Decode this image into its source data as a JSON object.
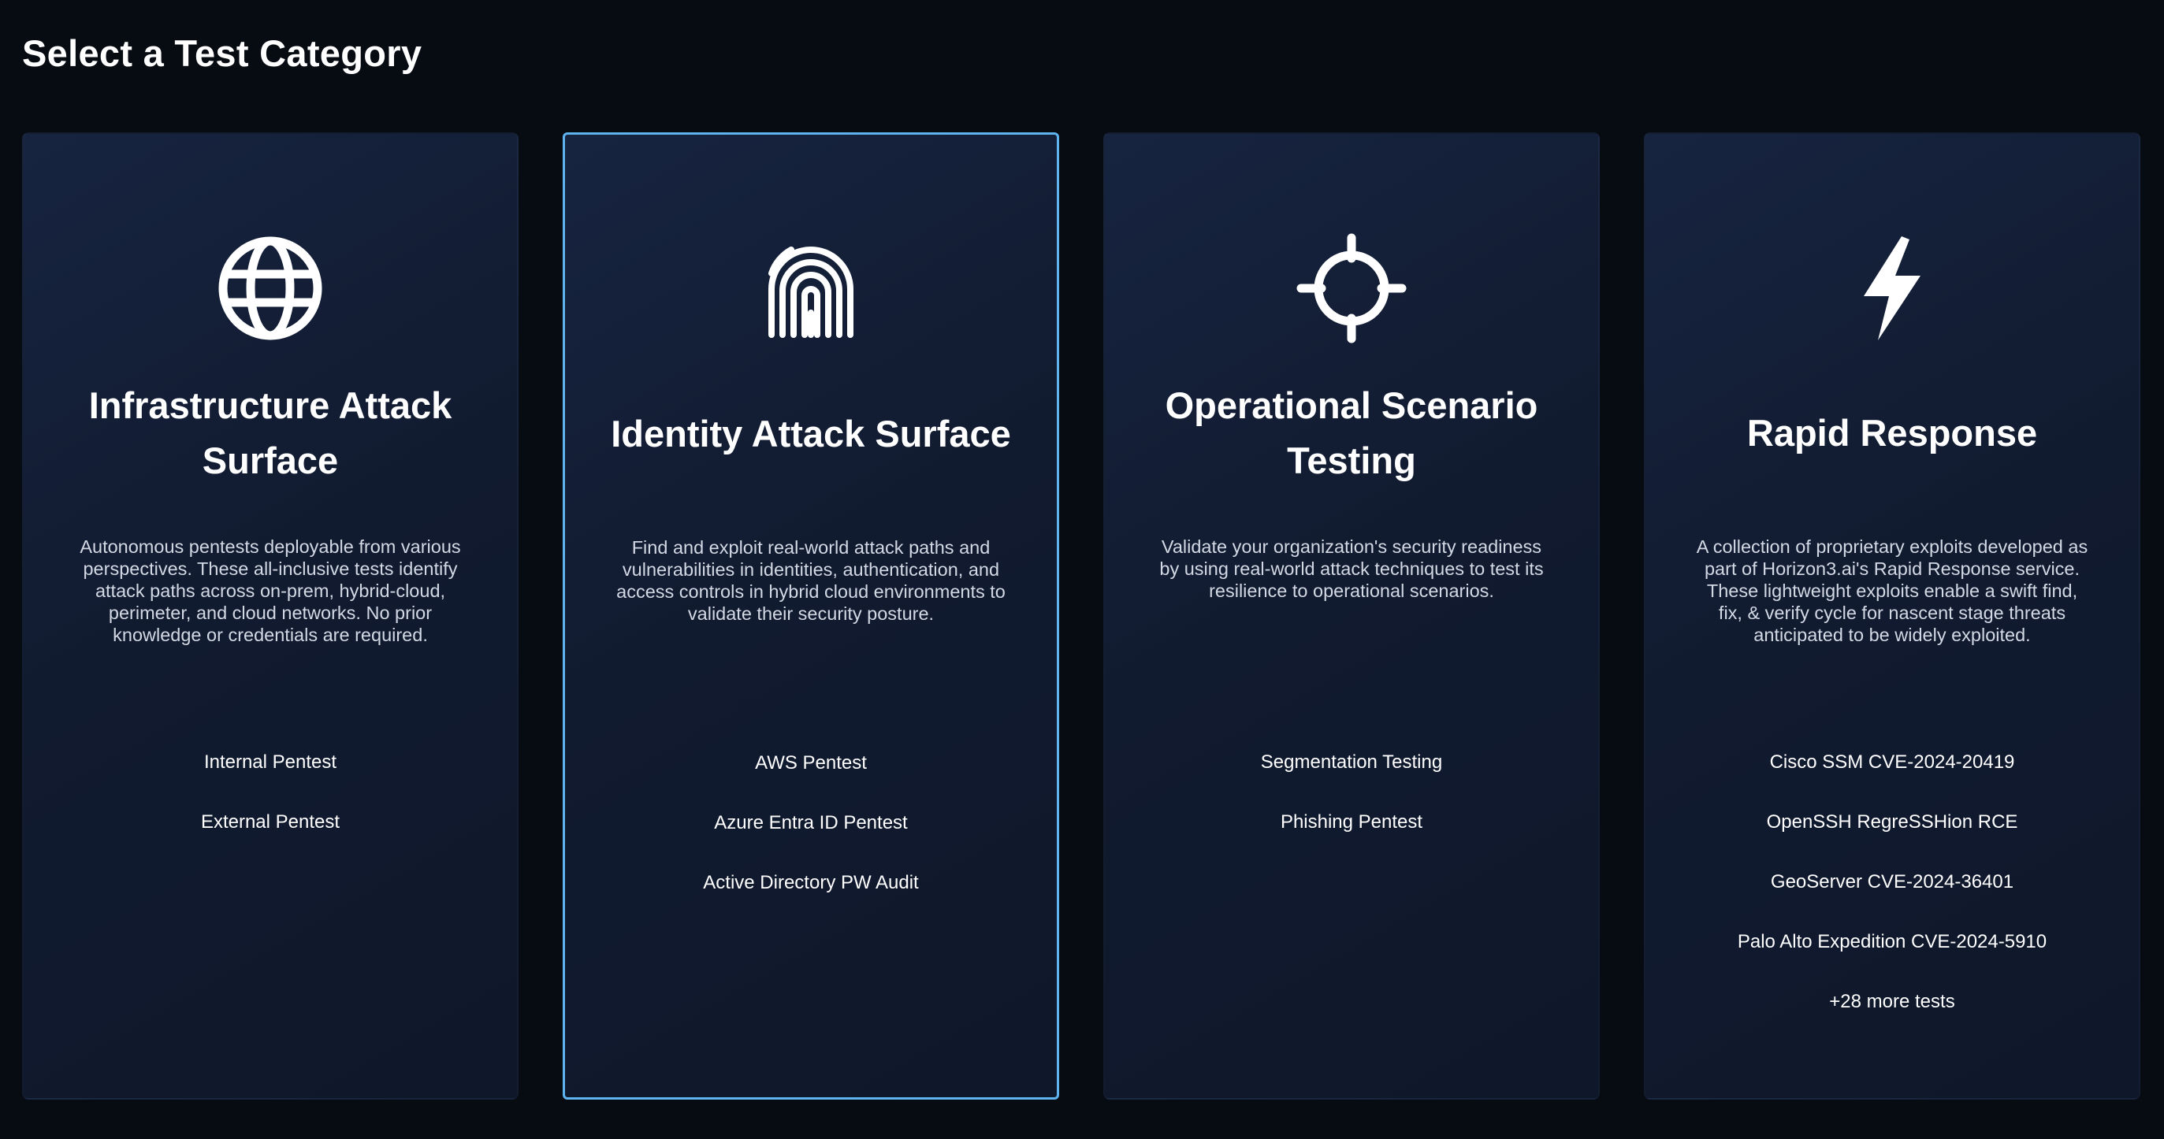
{
  "page": {
    "title": "Select a Test Category"
  },
  "colors": {
    "background": "#070b12",
    "card": "#131e36",
    "selected_border": "#5fb4f0",
    "text": "#ffffff",
    "muted_text": "#d3d9e4"
  },
  "cards": [
    {
      "icon": "globe-icon",
      "title": "Infrastructure Attack Surface",
      "description": "Autonomous pentests deployable from various perspectives. These all-inclusive tests identify attack paths across on-prem, hybrid-cloud, perimeter, and cloud networks. No prior knowledge or credentials are required.",
      "tests": [
        "Internal Pentest",
        "External Pentest"
      ]
    },
    {
      "icon": "fingerprint-icon",
      "title": "Identity Attack Surface",
      "description": "Find and exploit real-world attack paths and vulnerabilities in identities, authentication, and access controls in hybrid cloud environments to validate their security posture.",
      "tests": [
        "AWS Pentest",
        "Azure Entra ID Pentest",
        "Active Directory PW Audit"
      ],
      "selected": true
    },
    {
      "icon": "crosshair-icon",
      "title": "Operational Scenario Testing",
      "description": "Validate your organization's security readiness by using real-world attack techniques to test its resilience to operational scenarios.",
      "tests": [
        "Segmentation Testing",
        "Phishing Pentest"
      ]
    },
    {
      "icon": "lightning-icon",
      "title": "Rapid Response",
      "description": "A collection of proprietary exploits developed as part of Horizon3.ai's Rapid Response service. These lightweight exploits enable a swift find, fix, & verify cycle for nascent stage threats anticipated to be widely exploited.",
      "tests": [
        "Cisco SSM CVE-2024-20419",
        "OpenSSH RegreSSHion RCE",
        "GeoServer CVE-2024-36401",
        "Palo Alto Expedition CVE-2024-5910",
        "+28 more tests"
      ]
    }
  ]
}
